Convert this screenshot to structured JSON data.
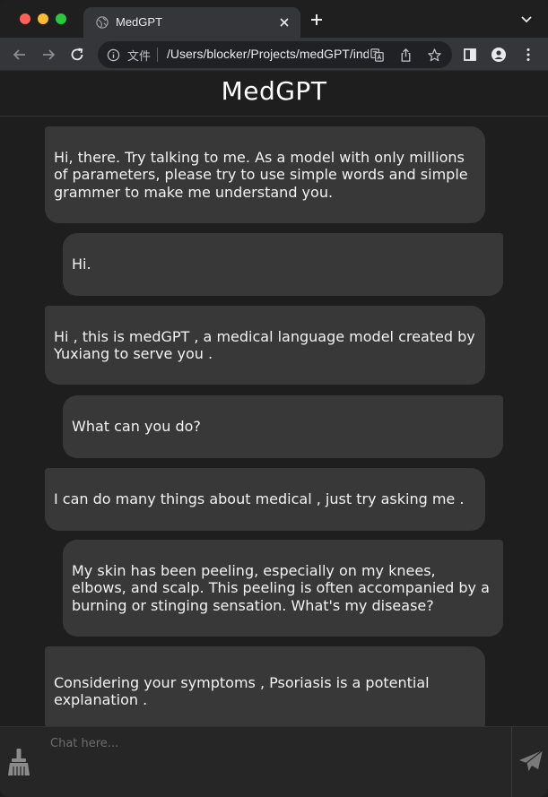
{
  "browser": {
    "tab_title": "MedGPT",
    "omnibox_scheme": "文件",
    "omnibox_url": "/Users/blocker/Projects/medGPT/index.html"
  },
  "app": {
    "title": "MedGPT"
  },
  "messages": [
    {
      "role": "bot",
      "text": "Hi, there. Try talking to me. As a model with only millions of parameters, please try to use simple words and simple grammer to make me understand you."
    },
    {
      "role": "user",
      "text": "Hi."
    },
    {
      "role": "bot",
      "text": "Hi , this is medGPT , a medical language model created by Yuxiang to serve you ."
    },
    {
      "role": "user",
      "text": "What can you do?"
    },
    {
      "role": "bot",
      "text": "I can do many things about medical , just try asking me ."
    },
    {
      "role": "user",
      "text": "My skin has been peeling, especially on my knees, elbows, and scalp. This peeling is often accompanied by a burning or stinging sensation. What's my disease?"
    },
    {
      "role": "bot",
      "text": "Considering your symptoms , Psoriasis is a potential explanation ."
    }
  ],
  "input": {
    "placeholder": "Chat here..."
  },
  "icons": {
    "clear": "broom-icon",
    "send": "paper-plane-icon"
  },
  "colors": {
    "bubble": "#383838",
    "background": "#1e1e1e",
    "close": "#fe5f57",
    "minimize": "#febc2e",
    "maximize": "#28c840"
  }
}
